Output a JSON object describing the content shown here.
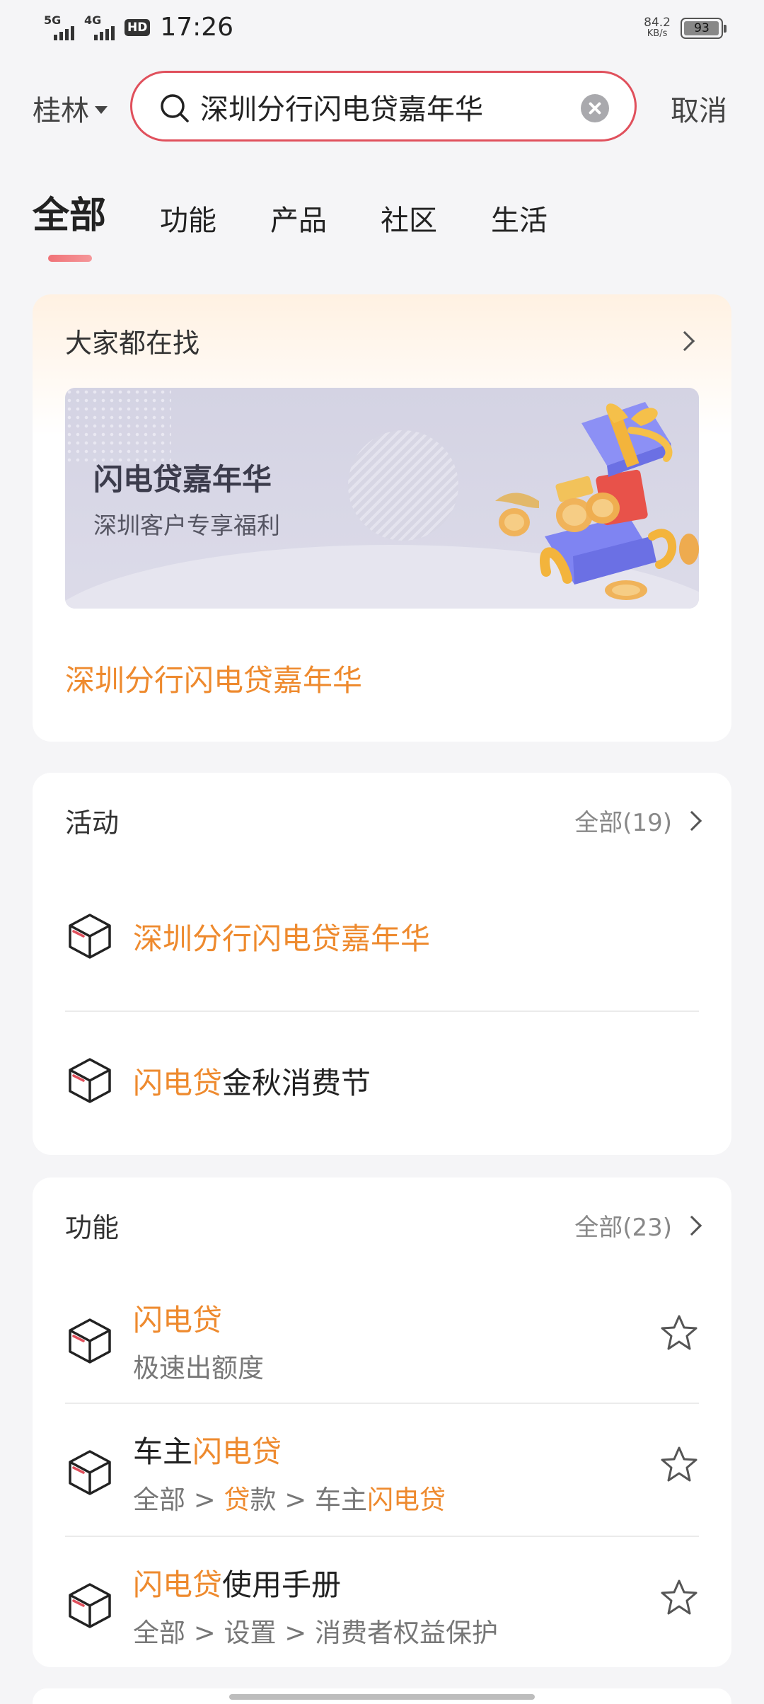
{
  "status_bar": {
    "network1": "5G",
    "network2": "4G",
    "hd": "HD",
    "time": "17:26",
    "speed_value": "84.2",
    "speed_unit": "KB/s",
    "battery": "93"
  },
  "search": {
    "city": "桂林",
    "query": "深圳分行闪电贷嘉年华",
    "cancel": "取消"
  },
  "tabs": [
    "全部",
    "功能",
    "产品",
    "社区",
    "生活"
  ],
  "hot": {
    "title": "大家都在找",
    "banner_title": "闪电贷嘉年华",
    "banner_subtitle": "深圳客户专享福利",
    "link": "深圳分行闪电贷嘉年华"
  },
  "activity": {
    "title": "活动",
    "see_all": "全部(19)",
    "items": [
      {
        "highlight": "深圳分行闪电贷嘉年华",
        "rest": ""
      },
      {
        "highlight": "闪电贷",
        "rest": "金秋消费节"
      }
    ]
  },
  "functions": {
    "title": "功能",
    "see_all": "全部(23)",
    "items": [
      {
        "pre": "",
        "highlight": "闪电贷",
        "post": "",
        "path": [
          "极速出额度"
        ]
      },
      {
        "pre": "车主",
        "highlight": "闪电贷",
        "post": "",
        "path_pre": "全部 > ",
        "path_hl": "贷",
        "path_mid": "款 > 车主",
        "path_hl2": "闪电贷"
      },
      {
        "pre": "",
        "highlight": "闪电贷",
        "post": "使用手册",
        "path": [
          "全部 > 设置 > 消费者权益保护"
        ]
      }
    ]
  },
  "icons": {
    "search": "search-icon",
    "clear": "clear-icon",
    "cube": "cube-icon",
    "star": "star-icon",
    "chevron": "chevron-right-icon"
  },
  "colors": {
    "accent_orange": "#ee8a2e",
    "search_border": "#e0505c",
    "tab_indicator": "#f07277"
  }
}
